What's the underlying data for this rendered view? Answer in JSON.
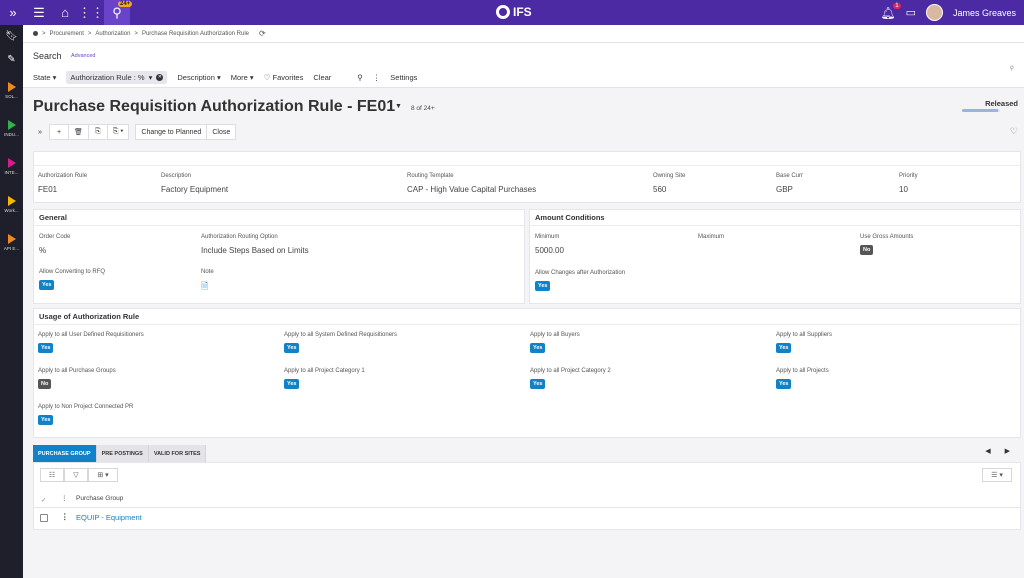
{
  "topbar": {
    "search_badge": "24+",
    "logo": "IFS",
    "notification_count": "1",
    "user_name": "James Greaves"
  },
  "rail": {
    "apps": [
      {
        "label": "SOL...",
        "color": "#f08a1c"
      },
      {
        "label": "INDU...",
        "color": "#2fb34a"
      },
      {
        "label": "INTE...",
        "color": "#d81b8c"
      },
      {
        "label": "Work...",
        "color": "#f5b800"
      },
      {
        "label": "API E...",
        "color": "#f08a1c"
      }
    ]
  },
  "breadcrumb": {
    "items": [
      "Procurement",
      "Authorization",
      "Purchase Requisition Authorization Rule"
    ],
    "separator": ">"
  },
  "search": {
    "title": "Search",
    "advanced": "Advanced",
    "filters": {
      "state": "State",
      "chip": "Authorization Rule : %",
      "description": "Description",
      "more": "More",
      "favorites": "Favorites",
      "clear": "Clear",
      "settings": "Settings"
    }
  },
  "header": {
    "title": "Purchase Requisition Authorization Rule - FE01",
    "record_count": "8 of 24+",
    "status": "Released",
    "status_progress": 0.95
  },
  "toolbar": {
    "change_to_planned": "Change to Planned",
    "close": "Close"
  },
  "summary": {
    "fields": [
      {
        "label": "Authorization Rule",
        "value": "FE01"
      },
      {
        "label": "Description",
        "value": "Factory Equipment"
      },
      {
        "label": "Routing Template",
        "value": "CAP - High Value Capital Purchases"
      },
      {
        "label": "Owning Site",
        "value": "560"
      },
      {
        "label": "Base Curr",
        "value": "GBP"
      },
      {
        "label": "Priority",
        "value": "10"
      }
    ]
  },
  "general": {
    "title": "General",
    "order_code_label": "Order Code",
    "order_code_value": "%",
    "routing_option_label": "Authorization Routing Option",
    "routing_option_value": "Include Steps Based on Limits",
    "allow_rfq_label": "Allow Converting to RFQ",
    "allow_rfq_value": "Yes",
    "note_label": "Note"
  },
  "amount": {
    "title": "Amount Conditions",
    "minimum_label": "Minimum",
    "minimum_value": "5000.00",
    "maximum_label": "Maximum",
    "gross_label": "Use Gross Amounts",
    "gross_value": "No",
    "allow_changes_label": "Allow Changes after Authorization",
    "allow_changes_value": "Yes"
  },
  "usage": {
    "title": "Usage of Authorization Rule",
    "items": [
      {
        "label": "Apply to all User Defined Requisitioners",
        "value": "Yes"
      },
      {
        "label": "Apply to all System Defined Requisitioners",
        "value": "Yes"
      },
      {
        "label": "Apply to all Buyers",
        "value": "Yes"
      },
      {
        "label": "Apply to all Suppliers",
        "value": "Yes"
      },
      {
        "label": "Apply to all Purchase Groups",
        "value": "No"
      },
      {
        "label": "Apply to all Project Category 1",
        "value": "Yes"
      },
      {
        "label": "Apply to all Project Category 2",
        "value": "Yes"
      },
      {
        "label": "Apply to all Projects",
        "value": "Yes"
      },
      {
        "label": "Apply to Non Project Connected PR",
        "value": "Yes"
      }
    ]
  },
  "tabs": [
    {
      "label": "PURCHASE GROUP",
      "active": true
    },
    {
      "label": "PRE POSTINGS",
      "active": false
    },
    {
      "label": "VALID FOR SITES",
      "active": false
    }
  ],
  "grid": {
    "column_header": "Purchase Group",
    "rows": [
      {
        "value": "EQUIP - Equipment"
      }
    ]
  },
  "colors": {
    "topbar": "#4b2aa3",
    "accent_blue": "#1282c6",
    "rail": "#1f1f2b"
  }
}
